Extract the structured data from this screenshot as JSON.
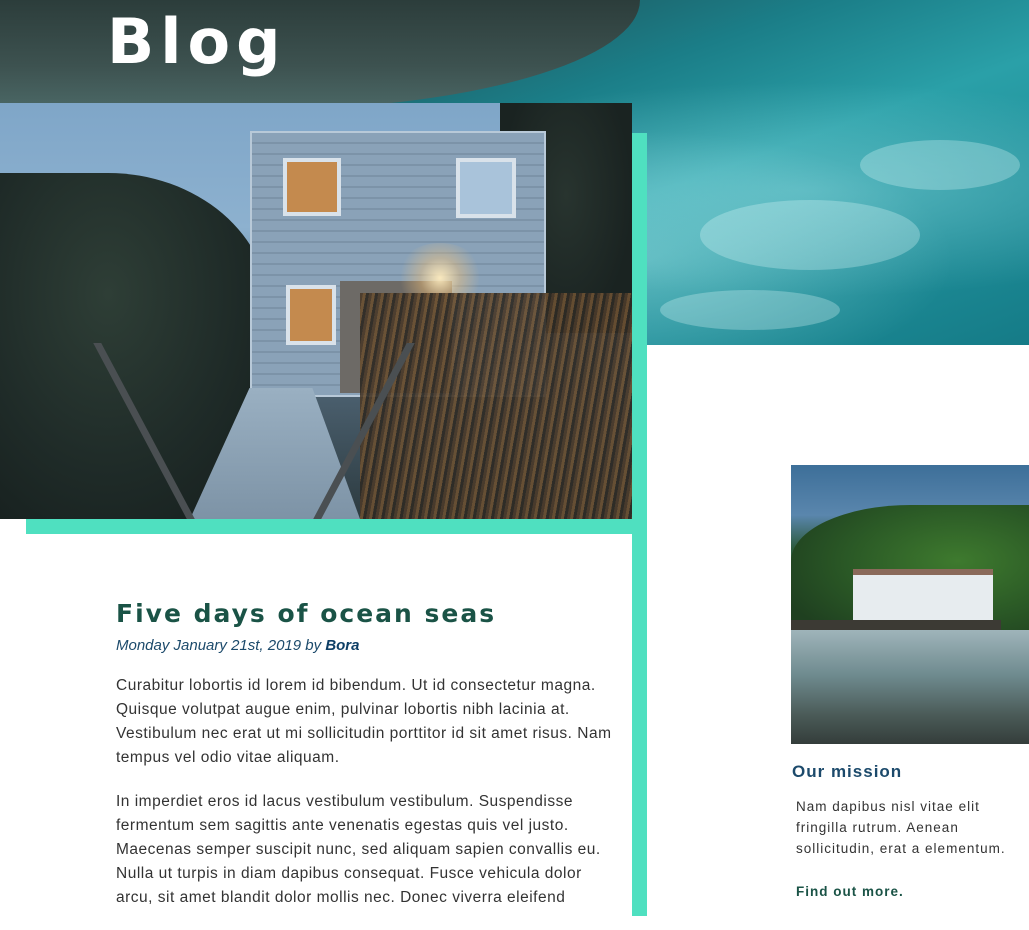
{
  "header": {
    "title": "Blog"
  },
  "post": {
    "title": "Five days of ocean seas",
    "date": "Monday January 21st, 2019",
    "by": "by",
    "author": "Bora",
    "paragraphs": [
      "Curabitur lobortis id lorem id bibendum. Ut id consectetur magna. Quisque volutpat augue enim, pulvinar lobortis nibh lacinia at. Vestibulum nec erat ut mi sollicitudin porttitor id sit amet risus. Nam tempus vel odio vitae aliquam.",
      "In imperdiet eros id lacus vestibulum vestibulum. Suspendisse fermentum sem sagittis ante venenatis egestas quis vel justo. Maecenas semper suscipit nunc, sed aliquam sapien convallis eu. Nulla ut turpis in diam dapibus consequat. Fusce vehicula dolor arcu, sit amet blandit dolor mollis nec. Donec viverra eleifend"
    ]
  },
  "sidebar": {
    "mission_title": "Our mission",
    "mission_text": "Nam dapibus nisl vitae elit fringilla rutrum. Aenean sollicitudin, erat a elementum.",
    "link_label": "Find out more."
  },
  "colors": {
    "accent": "#4fe0c0",
    "title_green": "#1a5346",
    "link_blue": "#1c4a6b"
  }
}
